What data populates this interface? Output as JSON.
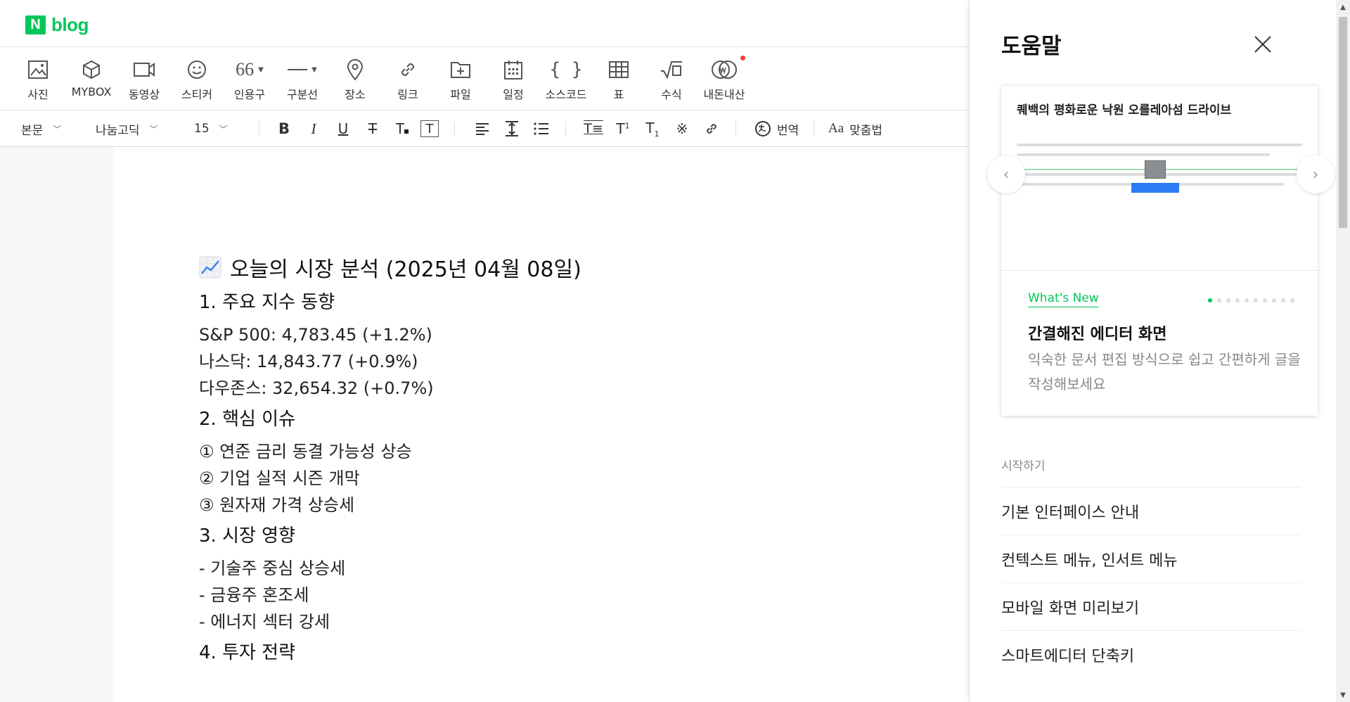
{
  "brand": {
    "logo_letter": "N",
    "logo_text": "blog",
    "color": "#03c75a"
  },
  "insert_toolbar": [
    {
      "label": "사진",
      "icon": "photo-icon"
    },
    {
      "label": "MYBOX",
      "icon": "mybox-icon"
    },
    {
      "label": "동영상",
      "icon": "video-icon"
    },
    {
      "label": "스티커",
      "icon": "sticker-icon"
    },
    {
      "label": "인용구",
      "icon": "quote-icon"
    },
    {
      "label": "구분선",
      "icon": "divider-icon"
    },
    {
      "label": "장소",
      "icon": "place-icon"
    },
    {
      "label": "링크",
      "icon": "link-icon"
    },
    {
      "label": "파일",
      "icon": "file-icon"
    },
    {
      "label": "일정",
      "icon": "calendar-icon"
    },
    {
      "label": "소스코드",
      "icon": "code-icon"
    },
    {
      "label": "표",
      "icon": "table-icon"
    },
    {
      "label": "수식",
      "icon": "formula-icon"
    },
    {
      "label": "내돈내산",
      "icon": "my-purchase-icon"
    }
  ],
  "format_toolbar": {
    "paragraph_style": "본문",
    "font": "나눔고딕",
    "font_size": "15",
    "translate_label": "번역",
    "spellcheck_label": "맞춤법"
  },
  "document": {
    "title": "오늘의 시장 분석 (2025년 04월 08일)",
    "sections": [
      {
        "heading": "1. 주요 지수 동향",
        "lines": [
          "S&P 500: 4,783.45 (+1.2%)",
          "나스닥: 14,843.77 (+0.9%)",
          "다우존스: 32,654.32 (+0.7%)"
        ]
      },
      {
        "heading": "2. 핵심 이슈",
        "lines": [
          "① 연준 금리 동결 가능성 상승",
          "② 기업 실적 시즌 개막",
          "③ 원자재 가격 상승세"
        ]
      },
      {
        "heading": "3. 시장 영향",
        "lines": [
          "- 기술주 중심 상승세",
          "- 금융주 혼조세",
          "- 에너지 섹터 강세"
        ]
      },
      {
        "heading": "4. 투자 전략",
        "lines": []
      }
    ]
  },
  "help_panel": {
    "title": "도움말",
    "card": {
      "preview_title": "퀘백의 평화로운 낙원 오를레아섬 드라이브",
      "tag": "What's New",
      "heading": "간결해진 에디터 화면",
      "description": "익숙한 문서 편집 방식으로 쉽고 간편하게 글을 작성해보세요",
      "dots_total": 10,
      "dots_active": 0
    },
    "section_label": "시작하기",
    "items": [
      "기본 인터페이스 안내",
      "컨텍스트 메뉴, 인서트 메뉴",
      "모바일 화면 미리보기",
      "스마트에디터 단축키"
    ]
  }
}
